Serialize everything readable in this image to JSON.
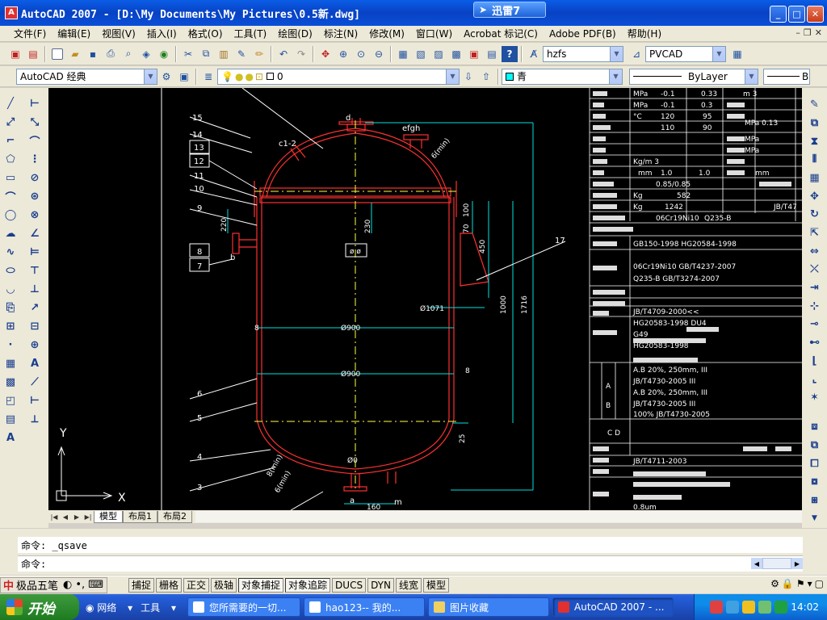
{
  "window": {
    "app_icon": "autocad-icon",
    "title": "AutoCAD 2007 - [D:\\My Documents\\My Pictures\\0.5新.dwg]",
    "xunlei_label": "迅雷7"
  },
  "menu": [
    "文件(F)",
    "编辑(E)",
    "视图(V)",
    "插入(I)",
    "格式(O)",
    "工具(T)",
    "绘图(D)",
    "标注(N)",
    "修改(M)",
    "窗口(W)",
    "Acrobat 标记(C)",
    "Adobe PDF(B)",
    "帮助(H)"
  ],
  "toolbar": {
    "text_style": "hzfs",
    "dim_style": "PVCAD",
    "workspace": "AutoCAD 经典",
    "layer": "0",
    "color": "青",
    "linetype": "ByLayer",
    "lineweight": "B"
  },
  "layout_tabs": [
    "模型",
    "布局1",
    "布局2"
  ],
  "command": {
    "line1": "命令: _qsave",
    "line2": "命令:"
  },
  "ime": {
    "name": "极品五笔"
  },
  "status_buttons": [
    "捕捉",
    "栅格",
    "正交",
    "极轴",
    "对象捕捉",
    "对象追踪",
    "DUCS",
    "DYN",
    "线宽",
    "模型"
  ],
  "taskbar": {
    "start": "开始",
    "quick": [
      "网络",
      "工具"
    ],
    "tasks": [
      "您所需要的一切...",
      "hao123-- 我的...",
      "图片收藏",
      "AutoCAD 2007 - ..."
    ],
    "clock": "14:02"
  },
  "drawing": {
    "part_labels": [
      "15",
      "14",
      "13",
      "12",
      "11",
      "10",
      "9",
      "8",
      "7",
      "6",
      "5",
      "4",
      "3",
      "17"
    ],
    "nozzle_labels": [
      "c1-2",
      "d",
      "efgh",
      "b",
      "a",
      "m"
    ],
    "dimensions": [
      "Ø1071",
      "Ø900",
      "Ø900",
      "100",
      "70",
      "450",
      "230",
      "220",
      "1000",
      "1716",
      "25",
      "160",
      "8",
      "8",
      "6(min)",
      "8(min)",
      "6(min)"
    ],
    "table_rows": [
      [
        "MPa",
        "-0.1",
        "0.33",
        "m 3"
      ],
      [
        "MPa",
        "-0.1",
        "0.3",
        ""
      ],
      [
        "°C",
        "120",
        "95",
        "MPa  0.13"
      ],
      [
        "",
        "110",
        "90",
        "MPa"
      ],
      [
        "",
        "",
        "",
        "MPa"
      ],
      [
        "Kg/m 3",
        "",
        "",
        ""
      ],
      [
        "mm",
        "1.0",
        "1.0",
        "mm"
      ],
      [
        "",
        "0.85/0.85",
        "",
        ""
      ],
      [
        "Kg",
        "582",
        "",
        ""
      ],
      [
        "Kg",
        "1242",
        "",
        "JB/T47"
      ],
      [
        "",
        "06Cr19Ni10",
        "Q235-B",
        ""
      ]
    ],
    "spec_lines": [
      "GB150-1998 HG20584-1998",
      "06Cr19Ni10 GB/T4237-2007",
      "Q235-B GB/T3274-2007",
      "JB/T4709-2000<<",
      "HG20583-1998 DU4",
      "G49",
      "HG20583-1998",
      "A.B 20%, 250mm, III",
      "JB/T4730-2005 III",
      "A.B 20%, 250mm, III",
      "JB/T4730-2005 III",
      "100% JB/T4730-2005",
      "C D",
      "JB/T4711-2003",
      "0.8um"
    ],
    "table_side_labels": [
      "A",
      "B"
    ]
  }
}
